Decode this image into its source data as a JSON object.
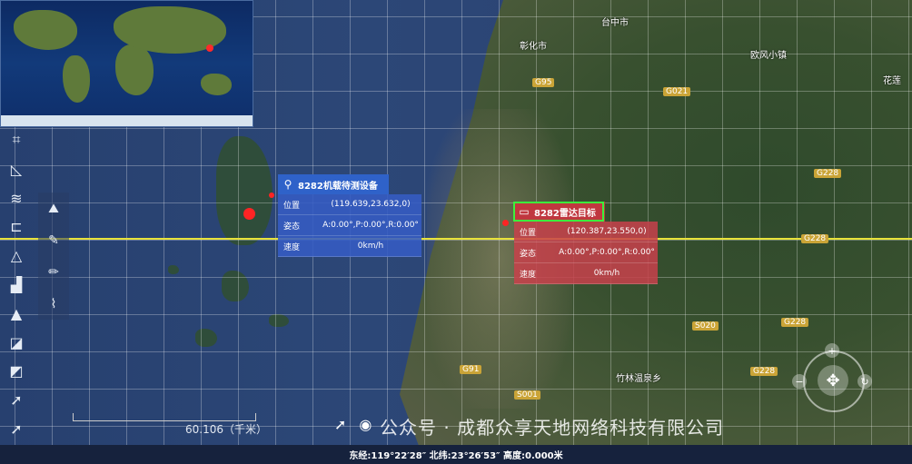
{
  "map": {
    "places": [
      {
        "name": "台中市"
      },
      {
        "name": "彰化市"
      },
      {
        "name": "欧风小镇"
      },
      {
        "name": "竹林温泉乡"
      },
      {
        "name": "花莲"
      }
    ],
    "roads": [
      "G95",
      "G021",
      "G228",
      "G228",
      "G228",
      "S020",
      "G228",
      "S001",
      "G91"
    ],
    "highlight_color": "#e8e23a"
  },
  "toolbar": {
    "icons": [
      "ruler-icon",
      "triangle-measure-icon",
      "wind-icon",
      "bracket-icon",
      "angle-icon",
      "chart-icon",
      "arrow-icon",
      "area-icon",
      "diagonal-area-icon",
      "cursor-icon",
      "cursor-alt-icon"
    ],
    "sub_icons": [
      "mountain-icon",
      "pen-icon",
      "pencil-icon",
      "brush-icon"
    ]
  },
  "popup_equipment": {
    "title": "8282机载待测设备",
    "rows": [
      {
        "label": "位置",
        "value": "(119.639,23.632,0)"
      },
      {
        "label": "姿态",
        "value": "A:0.00°,P:0.00°,R:0.00°"
      },
      {
        "label": "速度",
        "value": "0km/h"
      }
    ],
    "color": "#2f62c9"
  },
  "popup_radar": {
    "title": "8282雷达目标",
    "rows": [
      {
        "label": "位置",
        "value": "(120.387,23.550,0)"
      },
      {
        "label": "姿态",
        "value": "A:0.00°,P:0.00°,R:0.00°"
      },
      {
        "label": "速度",
        "value": "0km/h"
      }
    ],
    "color": "#c0373f"
  },
  "scale": {
    "text": "60.106（千米）"
  },
  "watermark": {
    "text": "公众号 · 成都众享天地网络科技有限公司"
  },
  "status": {
    "coords": "东经:119°22′28″ 北纬:23°26′53″ 高度:0.000米"
  }
}
